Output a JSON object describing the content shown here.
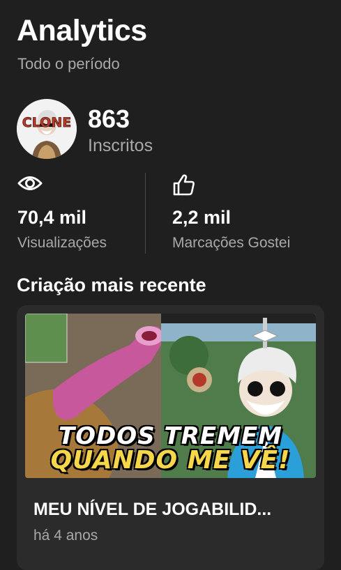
{
  "header": {
    "title": "Analytics",
    "period": "Todo o período"
  },
  "channel": {
    "avatar_icon": "channel-avatar-clone-logo",
    "avatar_text": "CLONE",
    "subscribers": "863",
    "subscribers_label": "Inscritos"
  },
  "stats": [
    {
      "icon": "eye-icon",
      "value": "70,4 mil",
      "label": "Visualizações"
    },
    {
      "icon": "thumbs-up-icon",
      "value": "2,2 mil",
      "label": "Marcações Gostei"
    }
  ],
  "latest": {
    "section_title": "Criação mais recente",
    "video": {
      "thumbnail_text_line1": "TODOS TREMEM",
      "thumbnail_text_line2": "QUANDO ME VÊ!",
      "title": "MEU NÍVEL DE JOGABILID...",
      "age": "há 4 anos"
    }
  },
  "colors": {
    "background": "#1f1f1f",
    "card": "#2b2b2b",
    "text_primary": "#ffffff",
    "text_secondary": "#a9a9a9",
    "divider": "#4a4a4a"
  }
}
